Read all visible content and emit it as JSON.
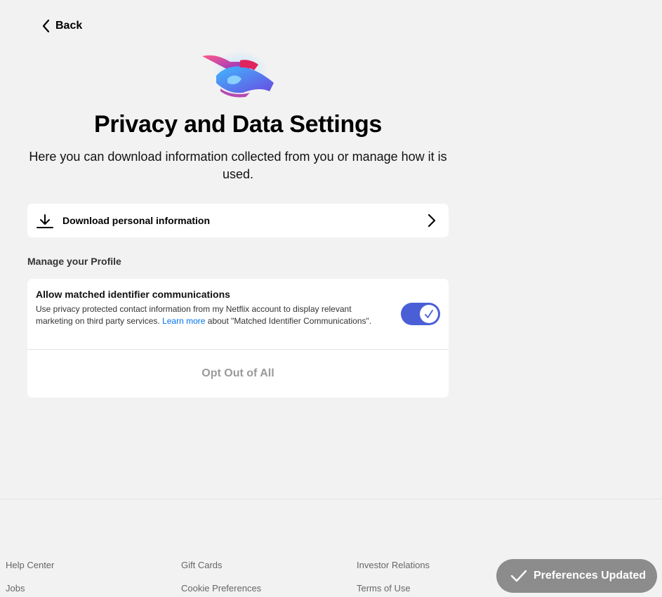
{
  "nav": {
    "back_label": "Back"
  },
  "header": {
    "title": "Privacy and Data Settings",
    "subtitle": "Here you can download information collected from you or manage how it is used."
  },
  "download": {
    "label": "Download personal information",
    "icon": "download-icon"
  },
  "profile": {
    "section_title": "Manage your Profile",
    "setting": {
      "title": "Allow matched identifier communications",
      "desc_before": "Use privacy protected contact information from my Netflix account to display relevant marketing on third party services. ",
      "link_text": "Learn more",
      "desc_after": " about \"Matched Identifier Communications\".",
      "enabled": true
    },
    "opt_out_label": "Opt Out of All"
  },
  "footer": {
    "col1": [
      "Help Center",
      "Jobs"
    ],
    "col2": [
      "Gift Cards",
      "Cookie Preferences"
    ],
    "col3": [
      "Investor Relations",
      "Terms of Use"
    ]
  },
  "toast": {
    "label": "Preferences Updated"
  },
  "colors": {
    "background": "#f2f2f2",
    "toggle_on": "#4a5fd6",
    "link": "#0071eb",
    "toast_bg": "#8c8c8c"
  }
}
